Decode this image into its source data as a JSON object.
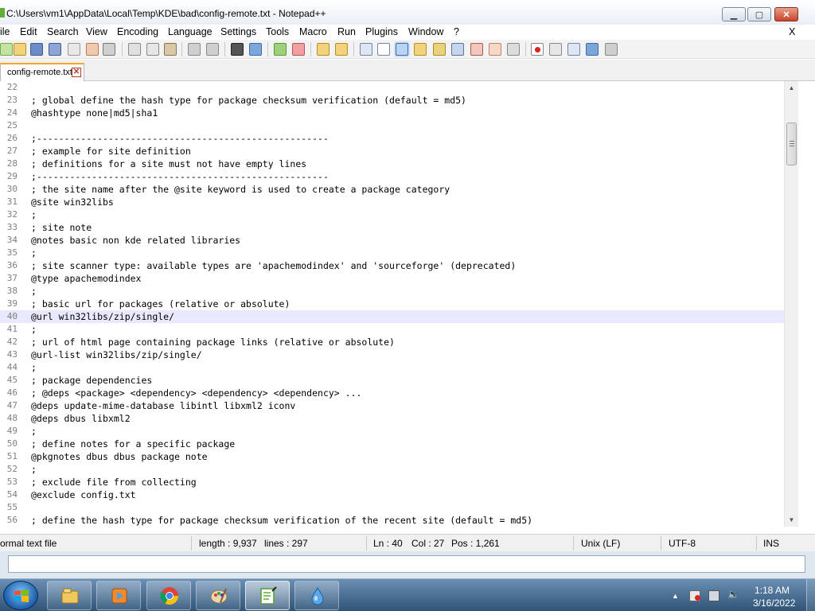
{
  "window": {
    "title": "C:\\Users\\vm1\\AppData\\Local\\Temp\\KDE\\bad\\config-remote.txt - Notepad++",
    "minimize_glyph": "▁",
    "maximize_glyph": "▢",
    "close_glyph": "✕"
  },
  "menubar": {
    "items": [
      "ile",
      "Edit",
      "Search",
      "View",
      "Encoding",
      "Language",
      "Settings",
      "Tools",
      "Macro",
      "Run",
      "Plugins",
      "Window",
      "?"
    ],
    "close_label": "X"
  },
  "toolbar": {
    "icons": [
      "new-file-icon",
      "open-file-icon",
      "save-icon",
      "save-all-icon",
      "close-icon",
      "close-all-icon",
      "print-icon",
      "cut-icon",
      "copy-icon",
      "paste-icon",
      "undo-icon",
      "redo-icon",
      "find-icon",
      "replace-icon",
      "zoom-in-icon",
      "zoom-out-icon",
      "sync-vertical-icon",
      "sync-horizontal-icon",
      "word-wrap-icon",
      "show-all-characters-icon",
      "indent-guide-icon",
      "user-language-icon",
      "document-map-icon",
      "function-list-icon",
      "folder-as-workspace-icon",
      "monitoring-icon",
      "record-macro-icon",
      "stop-recording-icon",
      "playback-macro-icon",
      "run-macro-multiple-icon",
      "save-macro-icon"
    ]
  },
  "tab": {
    "label": "config-remote.txt",
    "close_glyph": "✕"
  },
  "editor": {
    "current_line": 40,
    "lines": [
      {
        "n": "22",
        "text": ""
      },
      {
        "n": "23",
        "text": "; global define the hash type for package checksum verification (default = md5)"
      },
      {
        "n": "24",
        "text": "@hashtype none|md5|sha1"
      },
      {
        "n": "25",
        "text": ""
      },
      {
        "n": "26",
        "text": ";-----------------------------------------------------"
      },
      {
        "n": "27",
        "text": "; example for site definition"
      },
      {
        "n": "28",
        "text": "; definitions for a site must not have empty lines"
      },
      {
        "n": "29",
        "text": ";-----------------------------------------------------"
      },
      {
        "n": "30",
        "text": "; the site name after the @site keyword is used to create a package category"
      },
      {
        "n": "31",
        "text": "@site win32libs"
      },
      {
        "n": "32",
        "text": ";"
      },
      {
        "n": "33",
        "text": "; site note"
      },
      {
        "n": "34",
        "text": "@notes basic non kde related libraries"
      },
      {
        "n": "35",
        "text": ";"
      },
      {
        "n": "36",
        "text": "; site scanner type: available types are 'apachemodindex' and 'sourceforge' (deprecated)"
      },
      {
        "n": "37",
        "text": "@type apachemodindex"
      },
      {
        "n": "38",
        "text": ";"
      },
      {
        "n": "39",
        "text": "; basic url for packages (relative or absolute)"
      },
      {
        "n": "40",
        "text": "@url win32libs/zip/single/"
      },
      {
        "n": "41",
        "text": ";"
      },
      {
        "n": "42",
        "text": "; url of html page containing package links (relative or absolute)"
      },
      {
        "n": "43",
        "text": "@url-list win32libs/zip/single/"
      },
      {
        "n": "44",
        "text": ";"
      },
      {
        "n": "45",
        "text": "; package dependencies"
      },
      {
        "n": "46",
        "text": "; @deps <package> <dependency> <dependency> <dependency> ..."
      },
      {
        "n": "47",
        "text": "@deps update-mime-database libintl libxml2 iconv"
      },
      {
        "n": "48",
        "text": "@deps dbus libxml2"
      },
      {
        "n": "49",
        "text": ";"
      },
      {
        "n": "50",
        "text": "; define notes for a specific package"
      },
      {
        "n": "51",
        "text": "@pkgnotes dbus dbus package note"
      },
      {
        "n": "52",
        "text": ";"
      },
      {
        "n": "53",
        "text": "; exclude file from collecting"
      },
      {
        "n": "54",
        "text": "@exclude config.txt"
      },
      {
        "n": "55",
        "text": ""
      },
      {
        "n": "56",
        "text": "; define the hash type for package checksum verification of the recent site (default = md5)"
      }
    ]
  },
  "statusbar": {
    "file_type": "ormal text file",
    "length": "length : 9,937",
    "lines": "lines : 297",
    "ln": "Ln : 40",
    "col": "Col : 27",
    "pos": "Pos : 1,261",
    "eol": "Unix (LF)",
    "encoding": "UTF-8",
    "mode": "INS"
  },
  "taskbar": {
    "apps": [
      "explorer-icon",
      "media-player-icon",
      "chrome-icon",
      "paint-icon",
      "notepadpp-icon",
      "water-drop-icon"
    ],
    "active_app": "notepadpp-icon",
    "clock_time": "1:18 AM",
    "clock_date": "3/16/2022"
  }
}
